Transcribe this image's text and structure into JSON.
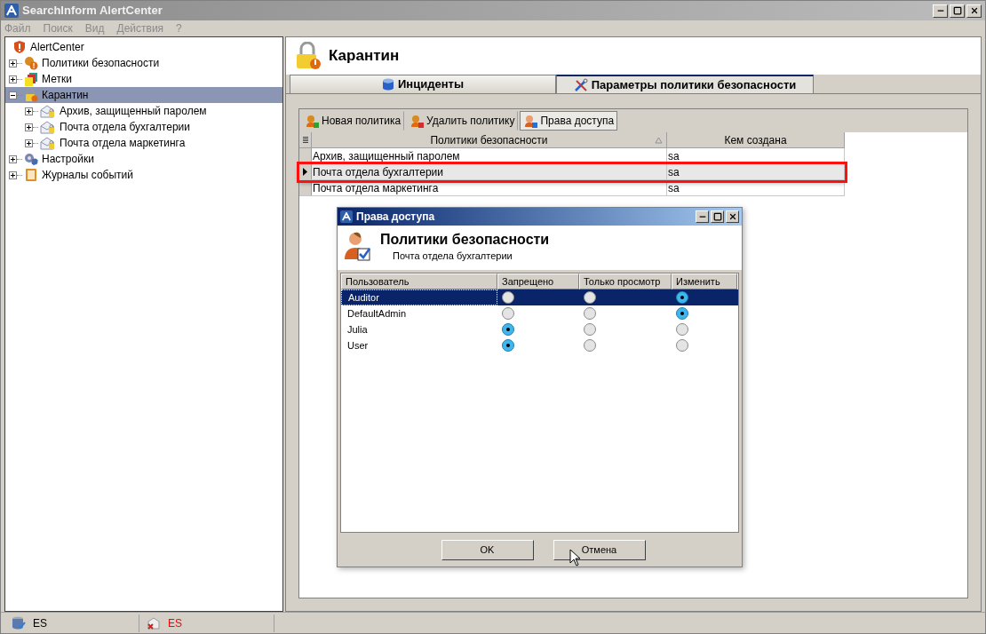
{
  "window": {
    "title": "SearchInform AlertCenter"
  },
  "menu": [
    "Файл",
    "Поиск",
    "Вид",
    "Действия",
    "?"
  ],
  "tree": [
    {
      "label": "AlertCenter",
      "kind": "shield",
      "selected": false,
      "children": [
        {
          "label": "Политики безопасности",
          "kind": "policy",
          "selected": false,
          "expanded": false
        },
        {
          "label": "Метки",
          "kind": "tags",
          "selected": false,
          "expanded": false
        },
        {
          "label": "Карантин",
          "kind": "lock",
          "selected": true,
          "expanded": true,
          "children": [
            {
              "label": "Архив, защищенный паролем",
              "kind": "mail",
              "selected": false,
              "expanded": false
            },
            {
              "label": "Почта отдела бухгалтерии",
              "kind": "mail",
              "selected": false,
              "expanded": false
            },
            {
              "label": "Почта отдела маркетинга",
              "kind": "mail",
              "selected": false,
              "expanded": false
            }
          ]
        },
        {
          "label": "Настройки",
          "kind": "settings",
          "selected": false,
          "expanded": false
        },
        {
          "label": "Журналы событий",
          "kind": "journal",
          "selected": false,
          "expanded": false
        }
      ]
    }
  ],
  "header": {
    "title": "Карантин"
  },
  "tabs": [
    {
      "label": "Инциденты",
      "kind": "db",
      "selected": false
    },
    {
      "label": "Параметры политики безопасности",
      "kind": "tools",
      "selected": true
    }
  ],
  "toolbar": [
    {
      "label": "Новая политика",
      "kind": "add",
      "selected": false
    },
    {
      "label": "Удалить политику",
      "kind": "delete",
      "selected": false
    },
    {
      "label": "Права доступа",
      "kind": "rights",
      "selected": true
    }
  ],
  "table": {
    "columns": [
      {
        "label": "Политики безопасности",
        "sorted": true
      },
      {
        "label": "Кем создана",
        "sorted": false
      }
    ],
    "rows": [
      {
        "cells": [
          "Архив, защищенный паролем",
          "sa"
        ],
        "selected": false,
        "highlighted": false
      },
      {
        "cells": [
          "Почта отдела бухгалтерии",
          "sa"
        ],
        "selected": true,
        "highlighted": true
      },
      {
        "cells": [
          "Почта отдела маркетинга",
          "sa"
        ],
        "selected": false,
        "highlighted": false
      }
    ]
  },
  "dialog": {
    "title": "Права доступа",
    "heading": "Политики безопасности",
    "subtitle": "Почта отдела бухгалтерии",
    "columns": [
      {
        "label": "Пользователь",
        "kind": "user"
      },
      {
        "label": "Запрещено",
        "kind": "deny"
      },
      {
        "label": "Только просмотр",
        "kind": "view"
      },
      {
        "label": "Изменить",
        "kind": "edit"
      }
    ],
    "rows": [
      {
        "user": "Auditor",
        "selected": true,
        "options": [
          {
            "selected": false
          },
          {
            "selected": false
          },
          {
            "selected": true
          }
        ]
      },
      {
        "user": "DefaultAdmin",
        "selected": false,
        "options": [
          {
            "selected": false
          },
          {
            "selected": false
          },
          {
            "selected": true
          }
        ]
      },
      {
        "user": "Julia",
        "selected": false,
        "options": [
          {
            "selected": true
          },
          {
            "selected": false
          },
          {
            "selected": false
          }
        ]
      },
      {
        "user": "User",
        "selected": false,
        "options": [
          {
            "selected": true
          },
          {
            "selected": false
          },
          {
            "selected": false
          }
        ]
      }
    ],
    "buttons": [
      "OK",
      "Отмена"
    ]
  },
  "status_bar": [
    {
      "label": "ES",
      "error": false
    },
    {
      "label": "ES",
      "error": true
    }
  ]
}
